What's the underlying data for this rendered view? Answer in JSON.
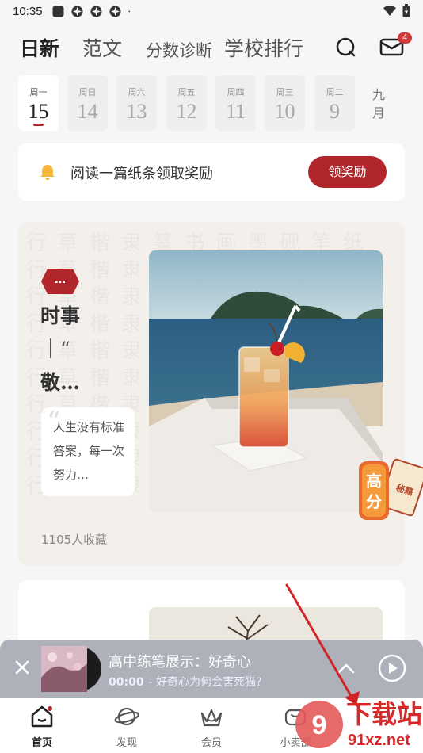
{
  "status": {
    "time": "10:35"
  },
  "header": {
    "tabs": [
      "日新",
      "范文",
      "分数诊断",
      "学校排行"
    ],
    "mail_badge": "4"
  },
  "dates": {
    "items": [
      {
        "weekday": "周一",
        "day": "15",
        "active": true
      },
      {
        "weekday": "周日",
        "day": "14"
      },
      {
        "weekday": "周六",
        "day": "13"
      },
      {
        "weekday": "周五",
        "day": "12"
      },
      {
        "weekday": "周四",
        "day": "11"
      },
      {
        "weekday": "周三",
        "day": "10"
      },
      {
        "weekday": "周二",
        "day": "9"
      }
    ],
    "month": "九月"
  },
  "reward": {
    "text": "阅读一篇纸条领取奖励",
    "button": "领奖励"
  },
  "article": {
    "badge": "…",
    "title_lines": [
      "时事",
      "｜“",
      "敬…"
    ],
    "quote": "人生没有标准答案，每一次努力…",
    "saves": "1105人收藏"
  },
  "sticker": {
    "line1": "高",
    "line2": "分",
    "tag": "秘籍"
  },
  "player": {
    "title": "高中练笔展示：好奇心",
    "time": "00:00",
    "subtitle": "- 好奇心为何会害死猫?"
  },
  "bottom_nav": [
    "首页",
    "发现",
    "会员",
    "小卖部"
  ],
  "watermark": {
    "main": "下载站",
    "url": "91xz.net"
  },
  "colors": {
    "accent": "#b0262b",
    "player_bg": "#aeb1ba"
  }
}
